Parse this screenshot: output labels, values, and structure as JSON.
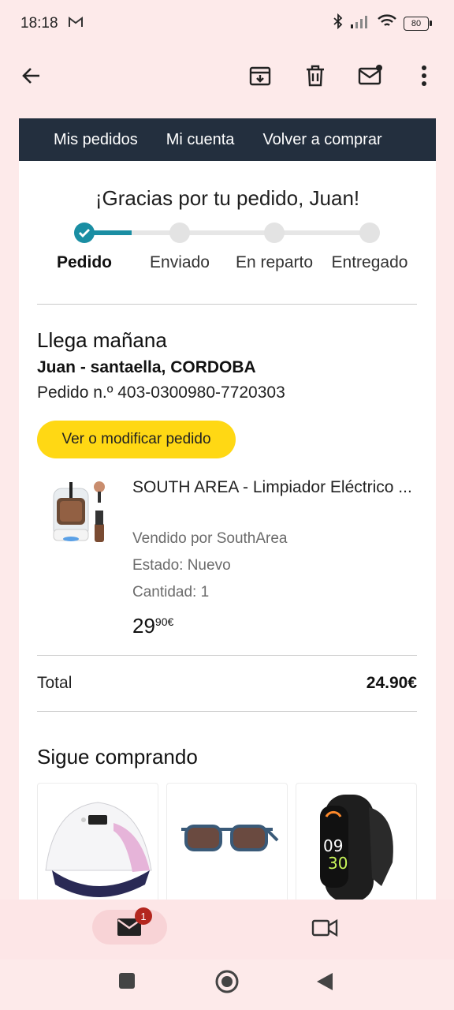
{
  "status_bar": {
    "time": "18:18",
    "battery": "80"
  },
  "nav": {
    "links": [
      "Mis pedidos",
      "Mi cuenta",
      "Volver a comprar"
    ]
  },
  "greeting": "¡Gracias por tu pedido, Juan!",
  "tracker": {
    "steps": [
      "Pedido",
      "Enviado",
      "En reparto",
      "Entregado"
    ],
    "current_step": 1
  },
  "delivery": {
    "title": "Llega mañana",
    "address": "Juan - santaella, CORDOBA",
    "order_number": "Pedido n.º 403-0300980-7720303",
    "modify_button": "Ver o modificar pedido"
  },
  "product": {
    "title": "SOUTH AREA - Limpiador Eléctrico ...",
    "seller": "Vendido por SouthArea",
    "condition": "Estado: Nuevo",
    "quantity": "Cantidad: 1",
    "price_whole": "29",
    "price_fraction": "90€"
  },
  "total": {
    "label": "Total",
    "value": "24.90€"
  },
  "keep_shopping": {
    "title": "Sigue comprando"
  },
  "bottom_nav": {
    "mail_badge": "1"
  },
  "colors": {
    "accent": "#1a8ea3",
    "button": "#ffd814",
    "nav_bg": "#232f3e",
    "badge": "#b3261e"
  }
}
